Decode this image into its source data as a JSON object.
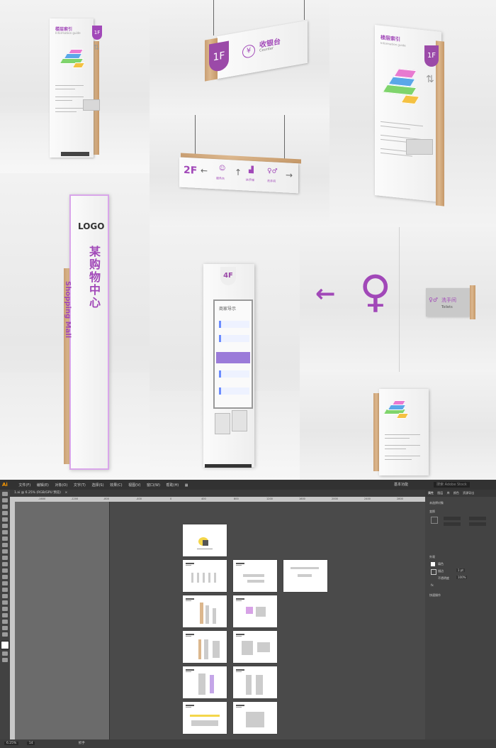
{
  "scene": {
    "floor_index_title": "楼层索引",
    "floor_index_subtitle": "Information guide",
    "floor_badge_1f": "1F",
    "floor_badge_2f": "2F",
    "floor_badge_4f": "4F",
    "counter_cn": "收银台",
    "counter_en": "Counter",
    "yen_symbol": "¥",
    "arrow_left": "←",
    "arrow_right": "→",
    "arrow_up": "↑",
    "logo_text": "LOGO",
    "mall_en": "Shopping Mall",
    "mall_cn": "某购物中心",
    "directory_title": "商家导示",
    "toilet_cn": "洗手间",
    "toilet_en": "Toilets",
    "hanging_labels": [
      "服务台",
      "扶手梯",
      "洗手间"
    ],
    "directory_entries": [
      "某某某品牌",
      "某某某品牌",
      "某某某品牌",
      "某某某品牌"
    ]
  },
  "illustrator": {
    "logo": "Ai",
    "menu": [
      "文件(F)",
      "编辑(E)",
      "对象(O)",
      "文字(T)",
      "选择(S)",
      "效果(C)",
      "视图(V)",
      "窗口(W)",
      "帮助(H)"
    ],
    "workspace": "基本功能",
    "search_placeholder": "搜索 Adobe Stock",
    "doc_tab": "1.ai @ 6.25% (RGB/GPU 预览)",
    "ruler_marks": [
      "-1600",
      "-1200",
      "-800",
      "-400",
      "0",
      "400",
      "800",
      "1200",
      "1600",
      "2000",
      "2400",
      "2800"
    ],
    "panel_tabs": [
      "属性",
      "图层",
      "库",
      "颜色",
      "资源导出"
    ],
    "panel_section_artboard": "未选择对象",
    "panel_section_transform": "变换",
    "panel_section_appearance": "外观",
    "fill_label": "填色",
    "stroke_label": "描边",
    "stroke_value": "1 pt",
    "opacity_label": "不透明度",
    "opacity_value": "100%",
    "fx_label": "fx",
    "quick_actions": "快速操作",
    "status_zoom": "6.25%",
    "status_page": "14",
    "status_tool": "抓手"
  }
}
